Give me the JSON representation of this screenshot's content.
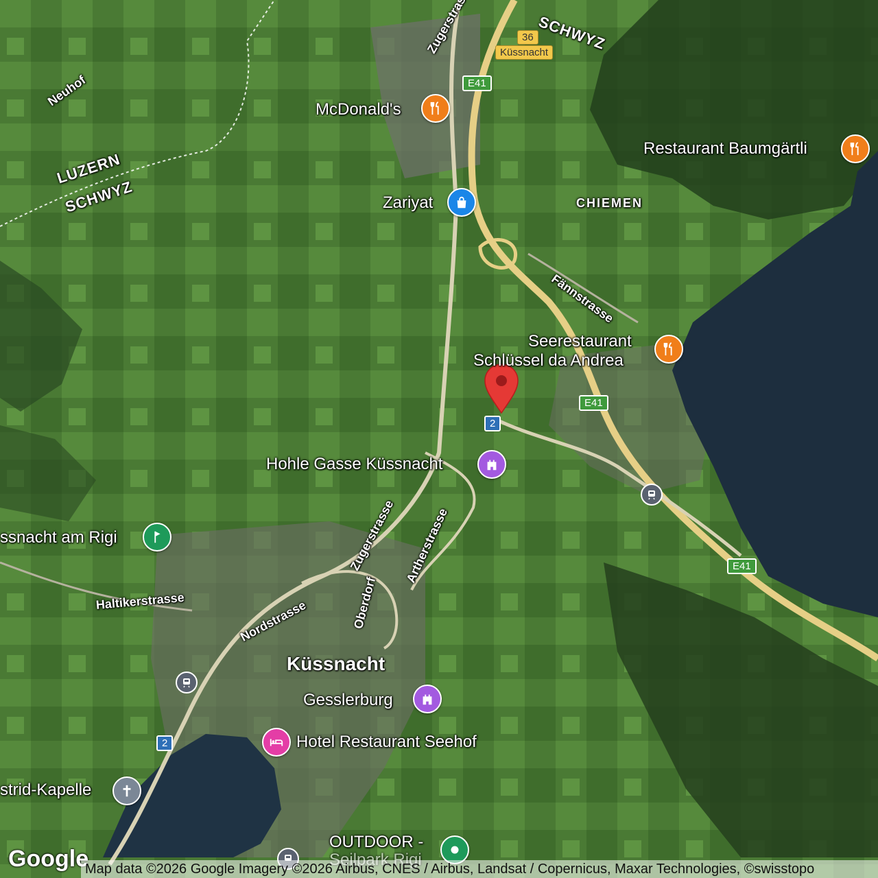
{
  "colors": {
    "food": "#f07e1a",
    "shopping": "#1a86e8",
    "landmark": "#a35ae0",
    "park": "#1e9a5a",
    "hotel": "#e43da6",
    "church": "#7b8796",
    "pin": "#e53935",
    "water": "#1d2e3e",
    "motorway": "#e6cf86"
  },
  "pois": [
    {
      "name": "McDonald's",
      "icon": "restaurant-icon",
      "category": "food"
    },
    {
      "name": "Restaurant Baumgärtli",
      "icon": "restaurant-icon",
      "category": "food"
    },
    {
      "name": "Zariyat",
      "icon": "shopping-bag-icon",
      "category": "shopping"
    },
    {
      "name": "Seerestaurant",
      "name2": "Schlüssel da Andrea",
      "icon": "restaurant-icon",
      "category": "food"
    },
    {
      "name": "Hohle Gasse Küssnacht",
      "icon": "castle-icon",
      "category": "landmark"
    },
    {
      "name": "ssnacht am Rigi",
      "icon": "golf-icon",
      "category": "park"
    },
    {
      "name": "Gesslerburg",
      "icon": "castle-icon",
      "category": "landmark"
    },
    {
      "name": "Hotel Restaurant Seehof",
      "icon": "bed-icon",
      "category": "hotel"
    },
    {
      "name": "strid-Kapelle",
      "icon": "cross-icon",
      "category": "church"
    },
    {
      "name": "OUTDOOR -",
      "name2": "Seilpark Rigi",
      "icon": "park-icon",
      "category": "park"
    }
  ],
  "places": {
    "town": "Küssnacht",
    "area": "CHIEMEN",
    "regions": [
      "SCHWYZ",
      "LUZERN",
      "SCHWYZ"
    ]
  },
  "streets": [
    "Zugerstrasse",
    "Neuhof",
    "Fännstrasse",
    "Zugerstrasse",
    "Nordstrasse",
    "Haltikerstrasse",
    "Oberdorf",
    "Artherstrasse"
  ],
  "shields": [
    {
      "label": "36",
      "style": "yellow"
    },
    {
      "label": "Küssnacht",
      "style": "yellow"
    },
    {
      "label": "E41",
      "style": "green"
    },
    {
      "label": "E41",
      "style": "green"
    },
    {
      "label": "E41",
      "style": "green"
    },
    {
      "label": "2",
      "style": "blue"
    },
    {
      "label": "2",
      "style": "blue"
    }
  ],
  "attribution": "Map data ©2026 Google Imagery ©2026 Airbus, CNES / Airbus, Landsat / Copernicus, Maxar Technologies, ©swisstopo",
  "logo": "Google"
}
